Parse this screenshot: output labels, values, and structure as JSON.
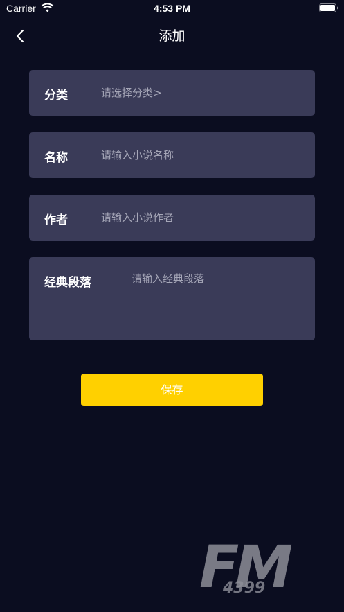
{
  "status_bar": {
    "carrier": "Carrier",
    "time": "4:53 PM"
  },
  "nav": {
    "title": "添加"
  },
  "form": {
    "category": {
      "label": "分类",
      "placeholder": "请选择分类>"
    },
    "name": {
      "label": "名称",
      "placeholder": "请输入小说名称"
    },
    "author": {
      "label": "作者",
      "placeholder": "请输入小说作者"
    },
    "passage": {
      "label": "经典段落",
      "placeholder": "请输入经典段落"
    }
  },
  "save_label": "保存",
  "watermark": {
    "brand": "FM",
    "number": "4399"
  },
  "colors": {
    "background": "#0b0d20",
    "field_background": "#3a3b58",
    "accent": "#ffd000"
  }
}
